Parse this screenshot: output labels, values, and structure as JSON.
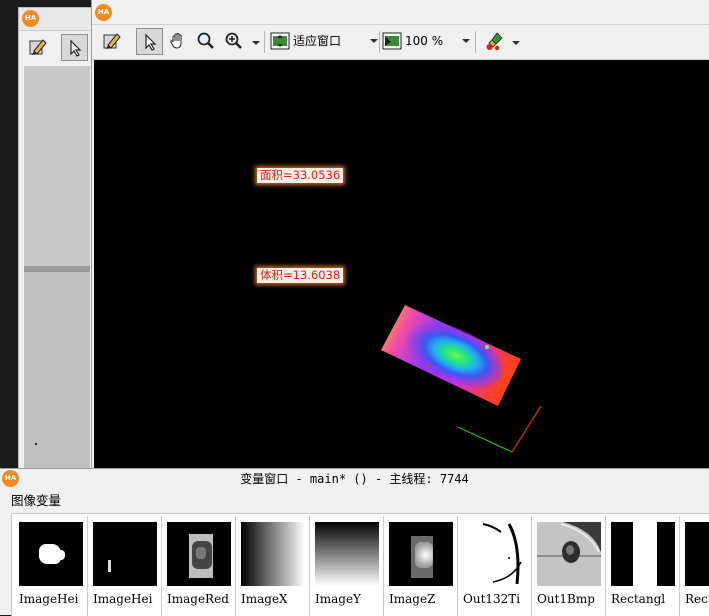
{
  "main_window": {
    "toolbar": {
      "zoom_mode": "适应窗口",
      "zoom_percent": "100 %"
    },
    "canvas": {
      "area_label": "面积=33.0536",
      "volume_label": "体积=13.6038"
    }
  },
  "variable_window": {
    "title": "变量窗口 - main* () - 主线程: 7744",
    "section_label": "图像变量",
    "images": [
      {
        "name": "ImageHei"
      },
      {
        "name": "ImageHei"
      },
      {
        "name": "ImageRed"
      },
      {
        "name": "ImageX"
      },
      {
        "name": "ImageY"
      },
      {
        "name": "ImageZ"
      },
      {
        "name": "Out132Ti"
      },
      {
        "name": "Out1Bmp"
      },
      {
        "name": "Rectangl"
      },
      {
        "name": "Rect"
      }
    ]
  },
  "colors": {
    "canvas_background": "#000000",
    "label_text": "#e02010",
    "label_glow": "#e67828",
    "logo": "#f18a21",
    "window_chrome": "#f0f0f0"
  },
  "icons": [
    "halcon-logo-icon",
    "pencil-tool-icon",
    "pointer-icon",
    "hand-pan-icon",
    "magnifier-icon",
    "zoom-in-icon",
    "fit-window-icon",
    "zoom-percent-icon",
    "paint-brush-icon"
  ]
}
